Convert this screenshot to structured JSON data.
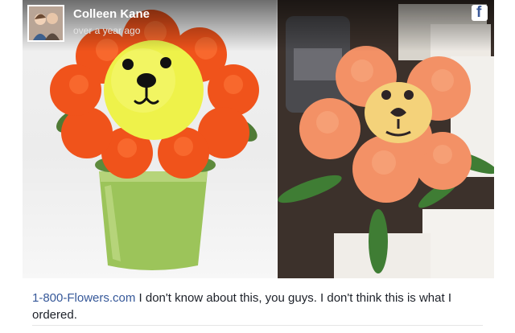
{
  "post": {
    "author": "Colleen Kane",
    "timestamp": "over a year ago",
    "platform_icon": "facebook-icon",
    "caption_link": "1-800-Flowers.com",
    "caption_text": " I don't know about this, you guys. I don't think this is what I ordered."
  },
  "colors": {
    "link": "#365899",
    "text": "#1d2129",
    "facebook_blue": "#3b5998"
  }
}
